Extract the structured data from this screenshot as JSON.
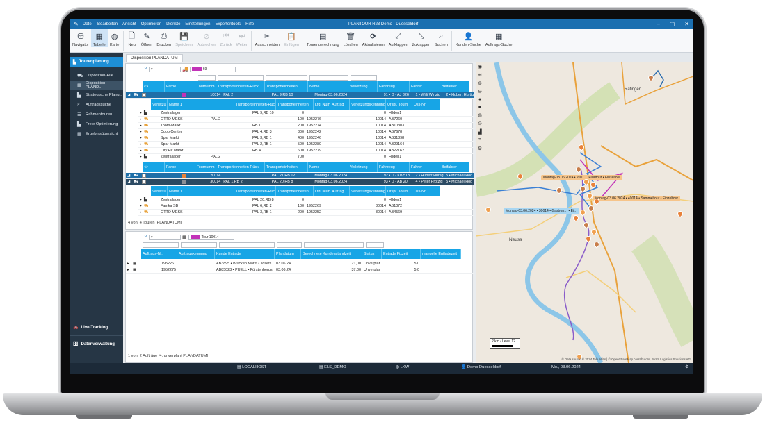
{
  "window": {
    "title": "PLANTOUR R23 Demo - Duesseldorf",
    "menu": [
      "Datei",
      "Bearbeiten",
      "Ansicht",
      "Optimieren",
      "Dienste",
      "Einstellungen",
      "Expertentools",
      "Hilfe"
    ]
  },
  "ribbon": {
    "buttons": [
      {
        "label": "Navigator",
        "icon": "database-icon"
      },
      {
        "label": "Tabelle",
        "icon": "table-icon",
        "selected": true
      },
      {
        "label": "Karte",
        "icon": "globe-icon"
      },
      {
        "label": "Neu",
        "icon": "new-icon"
      },
      {
        "label": "Öffnen",
        "icon": "edit-icon"
      },
      {
        "label": "Drucken",
        "icon": "printer-icon"
      },
      {
        "label": "Speichern",
        "icon": "save-icon",
        "disabled": true
      },
      {
        "label": "Abbrechen",
        "icon": "cancel-icon",
        "disabled": true
      },
      {
        "label": "Zurück",
        "icon": "back-icon",
        "disabled": true
      },
      {
        "label": "Weiter",
        "icon": "forward-icon",
        "disabled": true
      },
      {
        "label": "Ausschneiden",
        "icon": "scissors-icon"
      },
      {
        "label": "Einfügen",
        "icon": "paste-icon",
        "disabled": true
      },
      {
        "label": "Tourenberechnung",
        "icon": "calculator-icon"
      },
      {
        "label": "Löschen",
        "icon": "trash-icon"
      },
      {
        "label": "Aktualisieren",
        "icon": "refresh-icon"
      },
      {
        "label": "Aufklappen",
        "icon": "expand-icon"
      },
      {
        "label": "Zuklappen",
        "icon": "collapse-icon"
      },
      {
        "label": "Suchen",
        "icon": "search-icon"
      },
      {
        "label": "Kunden-Suche",
        "icon": "person-icon"
      },
      {
        "label": "Auftrags-Suche",
        "icon": "calendar-icon"
      }
    ]
  },
  "sidebar": {
    "header": "Tourenplanung",
    "items": [
      {
        "label": "Disposition-Alle",
        "icon": "car-icon"
      },
      {
        "label": "Disposition PLAND...",
        "icon": "calendar-icon",
        "selected": true
      },
      {
        "label": "Strategische Planu...",
        "icon": "chart-icon"
      },
      {
        "label": "Auftragssuche",
        "icon": "search-icon"
      },
      {
        "label": "Rahmentouren",
        "icon": "list-icon"
      },
      {
        "label": "Freie Optimierung",
        "icon": "chart-icon"
      },
      {
        "label": "Ergebnisübersicht",
        "icon": "grid-icon"
      }
    ],
    "footer": [
      "Live-Tracking",
      "Datenverwaltung"
    ]
  },
  "tab": {
    "label": "Disposition PLANDATUM"
  },
  "top_grid": {
    "filter_value": "69",
    "tour_headers": [
      "<>",
      "Farbe",
      "Tournumm",
      "Transporteinheiten-Rück",
      "Transporteinheiten",
      "Name",
      "Verletzung",
      "Fahrzeug",
      "Fahrer",
      "Beifahrer"
    ],
    "tour1": {
      "tournr": "10014",
      "rueck": "PAL 2",
      "te": "PAL 9,RB 10",
      "name": "Montag-03.06.2024",
      "fahrzeug": "91 • D - AJ 326",
      "fahrer": "1 • Willi Winzig",
      "beifahrer": "2 • Hubert Hurtig"
    },
    "stop_headers": [
      "Verletzu",
      "Name 1",
      "Transporteinheiten-Rück",
      "Transporteinheiten",
      "Lfd. Num",
      "Auftrag",
      "Verletzungskennung",
      "Urspr. Tourn",
      "Uss-Nr"
    ],
    "stops1": [
      {
        "name": "Zentrallager",
        "rueck": "",
        "te": "PAL 9,RB 10",
        "lfd": "0",
        "auftrag": "",
        "tour": "0",
        "uss": "Hilden1"
      },
      {
        "name": "OTTO MESS",
        "rueck": "PAL 2",
        "te": "",
        "lfd": "100",
        "auftrag": "1952276",
        "tour": "10014",
        "uss": "AB7260"
      },
      {
        "name": "Toom-Markt",
        "rueck": "",
        "te": "RB 1",
        "lfd": "200",
        "auftrag": "1952274",
        "tour": "10014",
        "uss": "AB10303"
      },
      {
        "name": "Coop Center",
        "rueck": "",
        "te": "PAL 4,RB 3",
        "lfd": "300",
        "auftrag": "1952242",
        "tour": "10014",
        "uss": "AB7678"
      },
      {
        "name": "Spar Markt",
        "rueck": "",
        "te": "PAL 3,RB 1",
        "lfd": "400",
        "auftrag": "1952246",
        "tour": "10014",
        "uss": "AB31898"
      },
      {
        "name": "Spar Markt",
        "rueck": "",
        "te": "PAL 2,RB 1",
        "lfd": "500",
        "auftrag": "1952280",
        "tour": "10014",
        "uss": "AB29164"
      },
      {
        "name": "City Hit Markt",
        "rueck": "",
        "te": "RB 4",
        "lfd": "600",
        "auftrag": "1952279",
        "tour": "10014",
        "uss": "AB22162"
      },
      {
        "name": "Zentrallager",
        "rueck": "PAL 2",
        "te": "",
        "lfd": "700",
        "auftrag": "",
        "tour": "0",
        "uss": "Hilden1"
      }
    ],
    "tour2": {
      "tournr": "20014",
      "rueck": "",
      "te": "PAL 21,RB 12",
      "name": "Montag-03.06.2024",
      "fahrzeug": "92 • D - KB 513",
      "fahrer": "2 • Hubert Hurtig",
      "beifahrer": "5 • Michael Hod"
    },
    "tour3": {
      "tournr": "30014",
      "rueck": "PAL 1,RB 2",
      "te": "PAL 20,RB 8",
      "name": "Montag-03.06.2024",
      "fahrzeug": "93 • D - AB 20",
      "fahrer": "4 • Peter Protzig",
      "beifahrer": "5 • Michael Hod"
    },
    "stops3": [
      {
        "name": "Zentrallager",
        "rueck": "",
        "te": "PAL 20,RB 8",
        "lfd": "0",
        "auftrag": "",
        "tour": "0",
        "uss": "Hilden1"
      },
      {
        "name": "Famka SB",
        "rueck": "",
        "te": "PAL 6,RB 2",
        "lfd": "100",
        "auftrag": "1952269",
        "tour": "30014",
        "uss": "AB1072"
      },
      {
        "name": "OTTO MESS",
        "rueck": "",
        "te": "PAL 3,RB 1",
        "lfd": "200",
        "auftrag": "1952252",
        "tour": "30014",
        "uss": "AB4569"
      }
    ],
    "status": "4  von:  4   Touren  [PLANDATUM]"
  },
  "bottom_grid": {
    "filter_value": "Tour 10014",
    "headers": [
      "Auftrags-Nr.",
      "Auftragskennung",
      "Kunde Entlade",
      "Plandatum",
      "Berechnete Kundenstandzeit",
      "Status",
      "Entlade Fixzeit",
      "manuelle Entladezeit"
    ],
    "rows": [
      {
        "nr": "1952261",
        "kunde": "AB3895 • Brücken Markt • Josefs",
        "datum": "03.06.24",
        "standzeit": "21,00",
        "status": "Unverplar",
        "fix": "5,0"
      },
      {
        "nr": "1952275",
        "kunde": "AB85023 • PUELL • Fürstenbergs",
        "datum": "03.06.24",
        "standzeit": "37,00",
        "status": "Unverplar",
        "fix": "5,0"
      }
    ],
    "status": "1  von:  2   Aufträge  [4, unverplant PLANDATUM]"
  },
  "map": {
    "labels": [
      {
        "text": "Montag-03.06.2024 • 2001… Filialtour • Einzeltour",
        "color": "#f6c48a"
      },
      {
        "text": "Montag-03.06.2024 • 40014 • Sammeltour • Einzeltour",
        "color": "#f6c48a"
      },
      {
        "text": "Montag-03.06.2024 • 30014 • Gastron… • Ei…",
        "color": "#a8d6f2"
      }
    ],
    "places": [
      "Ratingen",
      "Neuss"
    ],
    "scale": "2 km / Level 12",
    "attribution": "© Data source © 2024 Tele Atlas | © OpenStreetMap contributors, PASS Logistics Solutions AG"
  },
  "statusbar": {
    "server": "LOCALHOST",
    "db": "ELS_DEMO",
    "mode": "LKW",
    "user": "Demo Duesseldorf",
    "date": "Mo., 03.06.2024"
  },
  "colors": {
    "accent": "#17a5e6",
    "titlebar": "#1b6fb0",
    "sidebar": "#263645",
    "tour1": "#c233b8",
    "tour2": "#e8823a",
    "tour3": "#8a8f96"
  }
}
